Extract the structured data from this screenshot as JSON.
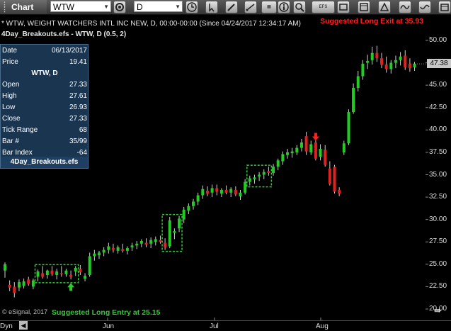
{
  "toolbar": {
    "app_title": "Chart",
    "symbol": "WTW",
    "interval": "D",
    "efs_label": "EFS"
  },
  "header": {
    "series_line": "* WTW, WEIGHT WATCHERS INTL INC NEW, D, 00:00-00:00 (Since 04/24/2017 12:34:17 AM)",
    "study_line": "4Day_Breakouts.efs - WTW, D (0.5, 2)",
    "exit_note": "Suggested Long Exit at 35.93",
    "entry_note": "Suggested Long Entry at 25.15",
    "copyright": "© eSignal, 2017"
  },
  "data_window": {
    "date_label": "Date",
    "date": "06/13/2017",
    "price_label": "Price",
    "price": "19.41",
    "symbol_header": "WTW, D",
    "rows": [
      {
        "label": "Open",
        "value": "27.33"
      },
      {
        "label": "High",
        "value": "27.61"
      },
      {
        "label": "Low",
        "value": "26.93"
      },
      {
        "label": "Close",
        "value": "27.33"
      },
      {
        "label": "Tick Range",
        "value": "68"
      },
      {
        "label": "Bar #",
        "value": "35/99"
      },
      {
        "label": "Bar Index",
        "value": "-64"
      }
    ],
    "footer": "4Day_Breakouts.efs"
  },
  "price_axis": {
    "labels": [
      "50.00",
      "47.50",
      "45.00",
      "42.50",
      "40.00",
      "37.50",
      "35.00",
      "32.50",
      "30.00",
      "27.50",
      "25.00",
      "22.50",
      "20.00"
    ],
    "last_price": "47.38"
  },
  "date_axis": {
    "labels": [
      {
        "text": "Jun",
        "pos": 0
      },
      {
        "text": "Jul",
        "pos": 1
      },
      {
        "text": "Aug",
        "pos": 2
      }
    ],
    "corner": "Dyn"
  },
  "colors": {
    "up": "#22cc22",
    "down": "#dd2222",
    "entry": "#2ecc2e",
    "exit": "#ff2020",
    "background": "#000000"
  },
  "chart_data": {
    "type": "candlestick",
    "ylim": [
      20,
      51.5
    ],
    "candles": [
      {
        "o": 24.3,
        "h": 25.2,
        "l": 23.5,
        "c": 25.0
      },
      {
        "o": 22.7,
        "h": 23.2,
        "l": 22.0,
        "c": 22.4
      },
      {
        "o": 22.5,
        "h": 23.0,
        "l": 21.3,
        "c": 21.8
      },
      {
        "o": 22.4,
        "h": 23.3,
        "l": 22.0,
        "c": 23.0
      },
      {
        "o": 22.6,
        "h": 23.4,
        "l": 22.3,
        "c": 23.1
      },
      {
        "o": 23.3,
        "h": 23.6,
        "l": 22.6,
        "c": 22.8
      },
      {
        "o": 22.5,
        "h": 23.4,
        "l": 22.2,
        "c": 23.2
      },
      {
        "o": 23.6,
        "h": 24.4,
        "l": 23.1,
        "c": 24.2
      },
      {
        "o": 24.0,
        "h": 24.8,
        "l": 23.4,
        "c": 23.6
      },
      {
        "o": 23.8,
        "h": 24.4,
        "l": 23.4,
        "c": 24.3
      },
      {
        "o": 24.3,
        "h": 24.8,
        "l": 23.7,
        "c": 23.9
      },
      {
        "o": 23.8,
        "h": 24.5,
        "l": 23.3,
        "c": 24.2
      },
      {
        "o": 24.0,
        "h": 24.8,
        "l": 23.6,
        "c": 23.9
      },
      {
        "o": 23.9,
        "h": 24.5,
        "l": 23.6,
        "c": 24.3
      },
      {
        "o": 23.8,
        "h": 24.3,
        "l": 23.3,
        "c": 23.6
      },
      {
        "o": 24.2,
        "h": 24.8,
        "l": 23.7,
        "c": 24.6
      },
      {
        "o": 24.5,
        "h": 24.9,
        "l": 23.8,
        "c": 24.1
      },
      {
        "o": 23.4,
        "h": 24.0,
        "l": 23.1,
        "c": 23.7
      },
      {
        "o": 23.8,
        "h": 26.3,
        "l": 23.6,
        "c": 25.9
      },
      {
        "o": 25.9,
        "h": 26.6,
        "l": 25.4,
        "c": 26.2
      },
      {
        "o": 26.0,
        "h": 26.5,
        "l": 25.6,
        "c": 26.3
      },
      {
        "o": 26.3,
        "h": 26.9,
        "l": 25.9,
        "c": 26.6
      },
      {
        "o": 26.6,
        "h": 27.4,
        "l": 26.2,
        "c": 27.0
      },
      {
        "o": 26.8,
        "h": 27.3,
        "l": 26.3,
        "c": 26.6
      },
      {
        "o": 26.5,
        "h": 27.1,
        "l": 26.2,
        "c": 26.9
      },
      {
        "o": 26.7,
        "h": 27.3,
        "l": 26.3,
        "c": 26.5
      },
      {
        "o": 26.5,
        "h": 27.0,
        "l": 26.1,
        "c": 26.8
      },
      {
        "o": 26.9,
        "h": 27.4,
        "l": 26.5,
        "c": 27.1
      },
      {
        "o": 27.1,
        "h": 27.6,
        "l": 26.7,
        "c": 27.3
      },
      {
        "o": 27.3,
        "h": 27.8,
        "l": 26.9,
        "c": 27.6
      },
      {
        "o": 27.4,
        "h": 27.9,
        "l": 26.9,
        "c": 27.2
      },
      {
        "o": 27.3,
        "h": 28.0,
        "l": 26.8,
        "c": 27.7
      },
      {
        "o": 27.5,
        "h": 28.1,
        "l": 27.1,
        "c": 27.8
      },
      {
        "o": 27.7,
        "h": 28.2,
        "l": 27.3,
        "c": 27.5
      },
      {
        "o": 27.4,
        "h": 27.9,
        "l": 26.6,
        "c": 26.9
      },
      {
        "o": 27.0,
        "h": 30.3,
        "l": 26.8,
        "c": 29.9
      },
      {
        "o": 28.5,
        "h": 29.0,
        "l": 27.8,
        "c": 28.7
      },
      {
        "o": 29.0,
        "h": 30.4,
        "l": 28.6,
        "c": 30.1
      },
      {
        "o": 30.0,
        "h": 31.4,
        "l": 29.6,
        "c": 31.1
      },
      {
        "o": 31.0,
        "h": 31.8,
        "l": 30.6,
        "c": 31.5
      },
      {
        "o": 31.5,
        "h": 32.3,
        "l": 31.1,
        "c": 32.0
      },
      {
        "o": 32.0,
        "h": 33.0,
        "l": 31.6,
        "c": 32.7
      },
      {
        "o": 32.7,
        "h": 33.8,
        "l": 32.3,
        "c": 33.4
      },
      {
        "o": 33.2,
        "h": 33.7,
        "l": 32.6,
        "c": 32.9
      },
      {
        "o": 33.0,
        "h": 33.9,
        "l": 32.5,
        "c": 33.5
      },
      {
        "o": 33.5,
        "h": 33.9,
        "l": 32.7,
        "c": 33.1
      },
      {
        "o": 32.9,
        "h": 33.5,
        "l": 32.5,
        "c": 33.3
      },
      {
        "o": 33.3,
        "h": 33.8,
        "l": 32.8,
        "c": 33.0
      },
      {
        "o": 33.0,
        "h": 33.6,
        "l": 32.5,
        "c": 33.4
      },
      {
        "o": 33.3,
        "h": 33.7,
        "l": 32.6,
        "c": 32.8
      },
      {
        "o": 32.6,
        "h": 33.3,
        "l": 32.2,
        "c": 33.0
      },
      {
        "o": 33.0,
        "h": 34.5,
        "l": 32.8,
        "c": 34.2
      },
      {
        "o": 34.2,
        "h": 34.9,
        "l": 33.8,
        "c": 34.6
      },
      {
        "o": 34.5,
        "h": 35.0,
        "l": 34.0,
        "c": 34.7
      },
      {
        "o": 34.8,
        "h": 35.3,
        "l": 34.3,
        "c": 35.0
      },
      {
        "o": 35.0,
        "h": 35.6,
        "l": 34.5,
        "c": 35.3
      },
      {
        "o": 35.4,
        "h": 35.9,
        "l": 34.9,
        "c": 35.2
      },
      {
        "o": 35.2,
        "h": 36.2,
        "l": 34.9,
        "c": 35.9
      },
      {
        "o": 35.9,
        "h": 36.8,
        "l": 35.5,
        "c": 36.6
      },
      {
        "o": 36.5,
        "h": 37.6,
        "l": 36.1,
        "c": 37.3
      },
      {
        "o": 37.2,
        "h": 37.9,
        "l": 36.8,
        "c": 37.5
      },
      {
        "o": 37.4,
        "h": 38.0,
        "l": 36.9,
        "c": 37.6
      },
      {
        "o": 37.5,
        "h": 38.3,
        "l": 37.2,
        "c": 38.0
      },
      {
        "o": 38.0,
        "h": 39.0,
        "l": 37.6,
        "c": 38.6
      },
      {
        "o": 39.3,
        "h": 39.8,
        "l": 37.2,
        "c": 37.6
      },
      {
        "o": 37.5,
        "h": 38.8,
        "l": 37.2,
        "c": 38.4
      },
      {
        "o": 38.6,
        "h": 39.2,
        "l": 36.6,
        "c": 36.8
      },
      {
        "o": 37.0,
        "h": 38.4,
        "l": 36.6,
        "c": 37.9
      },
      {
        "o": 37.8,
        "h": 38.3,
        "l": 35.9,
        "c": 36.1
      },
      {
        "o": 35.7,
        "h": 36.5,
        "l": 33.8,
        "c": 34.0
      },
      {
        "o": 35.9,
        "h": 36.1,
        "l": 32.9,
        "c": 33.1
      },
      {
        "o": 33.3,
        "h": 33.6,
        "l": 32.6,
        "c": 32.9
      },
      {
        "o": 37.5,
        "h": 38.8,
        "l": 37.2,
        "c": 38.5
      },
      {
        "o": 38.5,
        "h": 42.3,
        "l": 38.3,
        "c": 42.0
      },
      {
        "o": 42.0,
        "h": 45.2,
        "l": 41.8,
        "c": 44.7
      },
      {
        "o": 44.7,
        "h": 46.6,
        "l": 44.3,
        "c": 46.0
      },
      {
        "o": 46.0,
        "h": 47.8,
        "l": 45.6,
        "c": 47.4
      },
      {
        "o": 47.5,
        "h": 48.4,
        "l": 46.8,
        "c": 47.7
      },
      {
        "o": 47.8,
        "h": 49.3,
        "l": 47.3,
        "c": 48.6
      },
      {
        "o": 48.6,
        "h": 49.4,
        "l": 47.6,
        "c": 48.0
      },
      {
        "o": 48.0,
        "h": 48.6,
        "l": 46.9,
        "c": 47.3
      },
      {
        "o": 47.3,
        "h": 48.2,
        "l": 46.4,
        "c": 46.8
      },
      {
        "o": 46.8,
        "h": 47.8,
        "l": 46.3,
        "c": 47.5
      },
      {
        "o": 47.5,
        "h": 48.3,
        "l": 46.9,
        "c": 47.8
      },
      {
        "o": 47.8,
        "h": 48.7,
        "l": 47.2,
        "c": 48.2
      },
      {
        "o": 48.3,
        "h": 48.9,
        "l": 46.7,
        "c": 47.0
      },
      {
        "o": 47.4,
        "h": 48.0,
        "l": 46.5,
        "c": 46.9
      },
      {
        "o": 47.0,
        "h": 47.6,
        "l": 46.6,
        "c": 47.38
      }
    ],
    "entry_boxes": [
      {
        "from": 7,
        "to": 15
      },
      {
        "from": 34,
        "to": 37
      },
      {
        "from": 52,
        "to": 56
      }
    ],
    "signals": [
      {
        "type": "entry",
        "bar": 14,
        "price": 22.5
      },
      {
        "type": "exit",
        "bar": 66,
        "price": 39.2
      }
    ]
  }
}
